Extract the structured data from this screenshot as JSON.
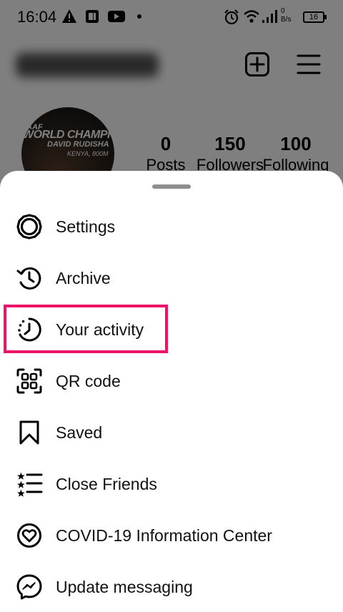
{
  "status_bar": {
    "time": "16:04",
    "net_speed_value": "0",
    "net_speed_unit": "B/s",
    "battery": "16"
  },
  "profile": {
    "avatar_text": [
      "IAAF",
      "WORLD CHAMPION",
      "DAVID RUDISHA",
      "KENYA, 800M"
    ],
    "stats": [
      {
        "value": "0",
        "label": "Posts"
      },
      {
        "value": "150",
        "label": "Followers"
      },
      {
        "value": "100",
        "label": "Following"
      }
    ],
    "header_icons": [
      "new-post-icon",
      "menu-icon"
    ]
  },
  "menu": {
    "highlighted_item": "your-activity",
    "highlight_color": "#ed1467",
    "items": [
      {
        "id": "settings",
        "label": "Settings",
        "icon": "settings-gear-icon"
      },
      {
        "id": "archive",
        "label": "Archive",
        "icon": "archive-history-icon"
      },
      {
        "id": "your-activity",
        "label": "Your activity",
        "icon": "activity-clock-icon"
      },
      {
        "id": "qr-code",
        "label": "QR code",
        "icon": "qr-code-icon"
      },
      {
        "id": "saved",
        "label": "Saved",
        "icon": "bookmark-icon"
      },
      {
        "id": "close-friends",
        "label": "Close Friends",
        "icon": "close-friends-list-icon"
      },
      {
        "id": "covid",
        "label": "COVID-19 Information Center",
        "icon": "covid-heart-icon"
      },
      {
        "id": "update-messaging",
        "label": "Update messaging",
        "icon": "messenger-icon"
      }
    ]
  }
}
